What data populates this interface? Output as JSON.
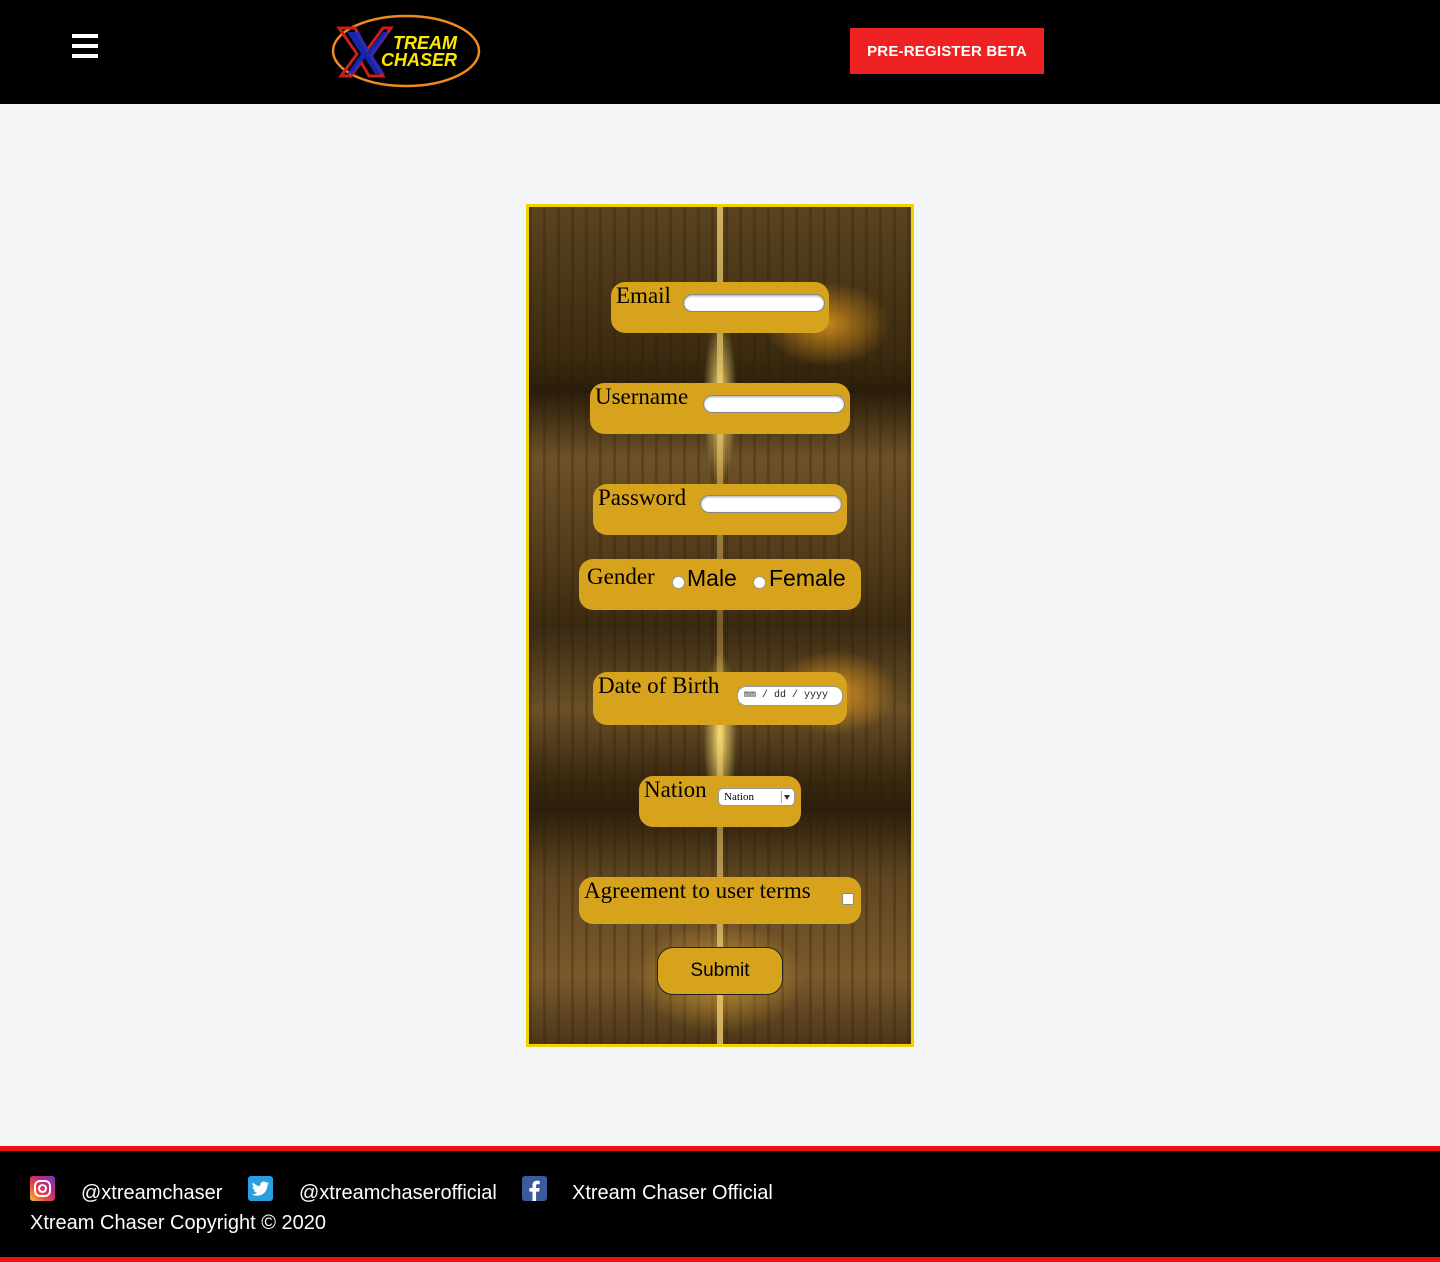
{
  "header": {
    "logo": {
      "line1": "TREAM",
      "line2": "CHASER"
    },
    "cta_label": "PRE-REGISTER BETA"
  },
  "form": {
    "email_label": "Email",
    "username_label": "Username",
    "password_label": "Password",
    "gender_label": "Gender",
    "gender_options": [
      "Male",
      "Female"
    ],
    "dob_label": "Date of Birth",
    "dob_placeholder": "mm / dd / yyyy",
    "nation_label": "Nation",
    "nation_selected": "Nation",
    "agreement_label": "Agreement to user terms",
    "submit_label": "Submit"
  },
  "footer": {
    "instagram_handle": "@xtreamchaser",
    "twitter_handle": "@xtreamchaserofficial",
    "facebook_name": "Xtream Chaser Official",
    "copyright": "Xtream Chaser Copyright © 2020"
  },
  "colors": {
    "header_bg": "#000000",
    "cta_bg": "#ee2222",
    "field_bg": "#d8a31c",
    "panel_border": "#f3d100",
    "footer_rule": "#ee1111"
  }
}
